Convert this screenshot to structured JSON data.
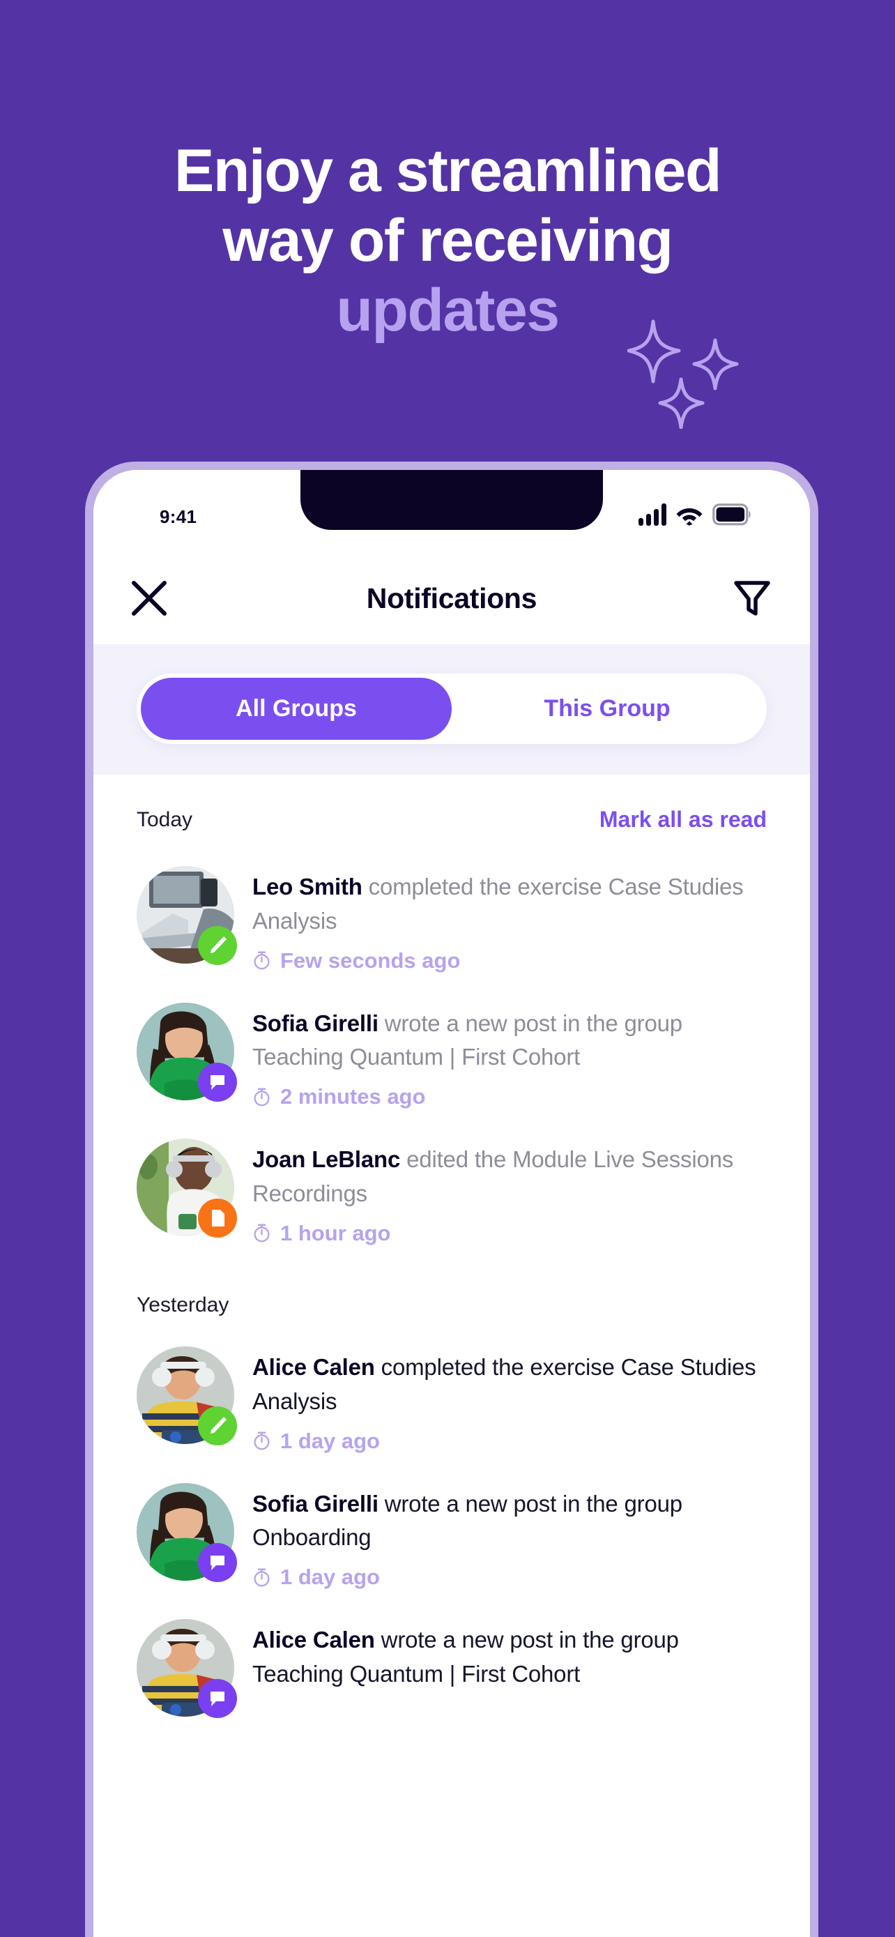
{
  "theme": {
    "background": "#5433a5",
    "accent": "#7b4ef0",
    "accent_light": "#b7a2ef",
    "frame": "#bfafe4",
    "green": "#5fd331",
    "orange": "#f97316",
    "purple_badge": "#7b3ff2"
  },
  "headline": {
    "line1": "Enjoy a streamlined",
    "line2": "way of receiving",
    "line3": "updates"
  },
  "decor": {
    "sparkle_icon": "sparkle-icon",
    "count": 3
  },
  "status_bar": {
    "time": "9:41",
    "signal_icon": "cellular-signal-icon",
    "wifi_icon": "wifi-icon",
    "battery_icon": "battery-icon"
  },
  "header": {
    "close_icon": "close-icon",
    "title": "Notifications",
    "filter_icon": "filter-icon"
  },
  "tabs": [
    {
      "label": "All Groups",
      "active": true
    },
    {
      "label": "This Group",
      "active": false
    }
  ],
  "list_head": {
    "day": "Today",
    "mark_all_label": "Mark all as read"
  },
  "yesterday_label": "Yesterday",
  "notifications_today": [
    {
      "who": "Leo Smith",
      "action": " completed the exercise Case Studies Analysis",
      "time": "Few seconds ago",
      "time_icon": "clock-icon",
      "badge_icon": "pencil-icon",
      "badge_color": "#5fd331",
      "avatar_name": "avatar-leo-smith",
      "muted": true
    },
    {
      "who": "Sofia Girelli",
      "action": " wrote a new post in the group Teaching Quantum | First Cohort",
      "time": "2 minutes ago",
      "time_icon": "clock-icon",
      "badge_icon": "comment-icon",
      "badge_color": "#7b3ff2",
      "avatar_name": "avatar-sofia-girelli",
      "muted": true
    },
    {
      "who": "Joan LeBlanc",
      "action": " edited the Module Live Sessions Recordings",
      "time": "1 hour ago",
      "time_icon": "clock-icon",
      "badge_icon": "document-icon",
      "badge_color": "#f97316",
      "avatar_name": "avatar-joan-leblanc",
      "muted": true
    }
  ],
  "notifications_yesterday": [
    {
      "who": "Alice Calen",
      "action": " completed the exercise Case Studies Analysis",
      "time": "1 day ago",
      "time_icon": "clock-icon",
      "badge_icon": "pencil-icon",
      "badge_color": "#5fd331",
      "avatar_name": "avatar-alice-calen",
      "muted": false
    },
    {
      "who": "Sofia Girelli",
      "action": " wrote a new post in the group Onboarding",
      "time": "1 day ago",
      "time_icon": "clock-icon",
      "badge_icon": "comment-icon",
      "badge_color": "#7b3ff2",
      "avatar_name": "avatar-sofia-girelli",
      "muted": false
    },
    {
      "who": "Alice Calen",
      "action": "  wrote a new post in the group Teaching Quantum | First Cohort",
      "time": "",
      "time_icon": "clock-icon",
      "badge_icon": "comment-icon",
      "badge_color": "#7b3ff2",
      "avatar_name": "avatar-alice-calen",
      "muted": false
    }
  ]
}
